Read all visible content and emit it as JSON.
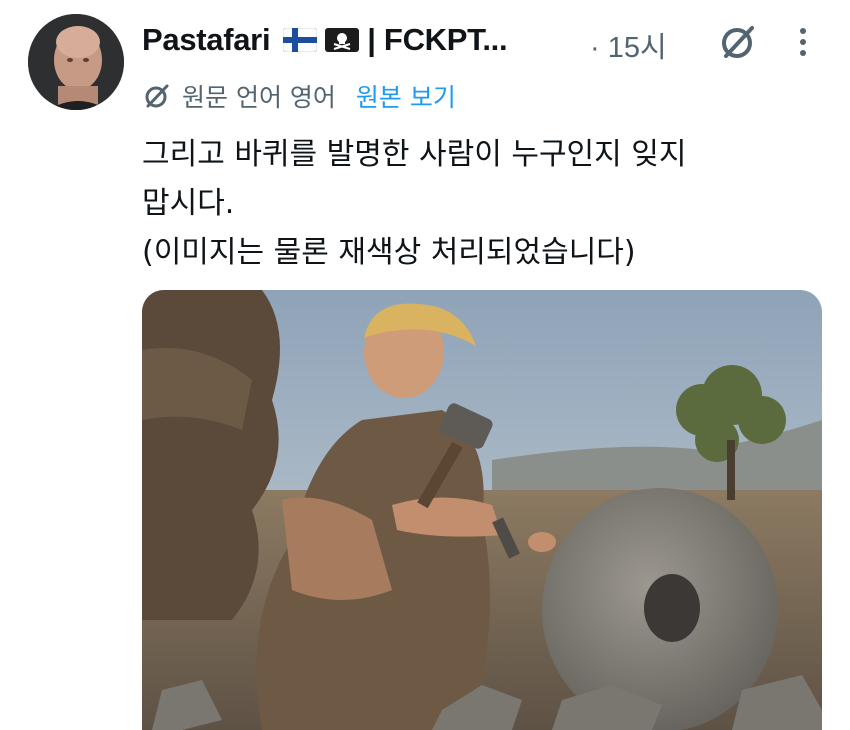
{
  "author": {
    "display_name": "Pastafari",
    "name_suffix": "| FCKPT...",
    "flag_icons": [
      "finland-flag-icon",
      "pirate-flag-icon"
    ]
  },
  "post": {
    "timestamp": "· 15시",
    "text": "그리고 바퀴를 발명한 사람이 누구인지 잊지\n맙시다.\n(이미지는 물론 재색상 처리되었습니다)"
  },
  "translation": {
    "note": "원문 언어 영어",
    "show_original": "원본 보기"
  },
  "icons": {
    "grok": "grok-slash-icon",
    "more": "more-vertical-icon",
    "translate": "translate-slash-icon"
  },
  "colors": {
    "link": "#1d9bf0",
    "secondary_text": "#536471",
    "primary_text": "#0f1419"
  }
}
